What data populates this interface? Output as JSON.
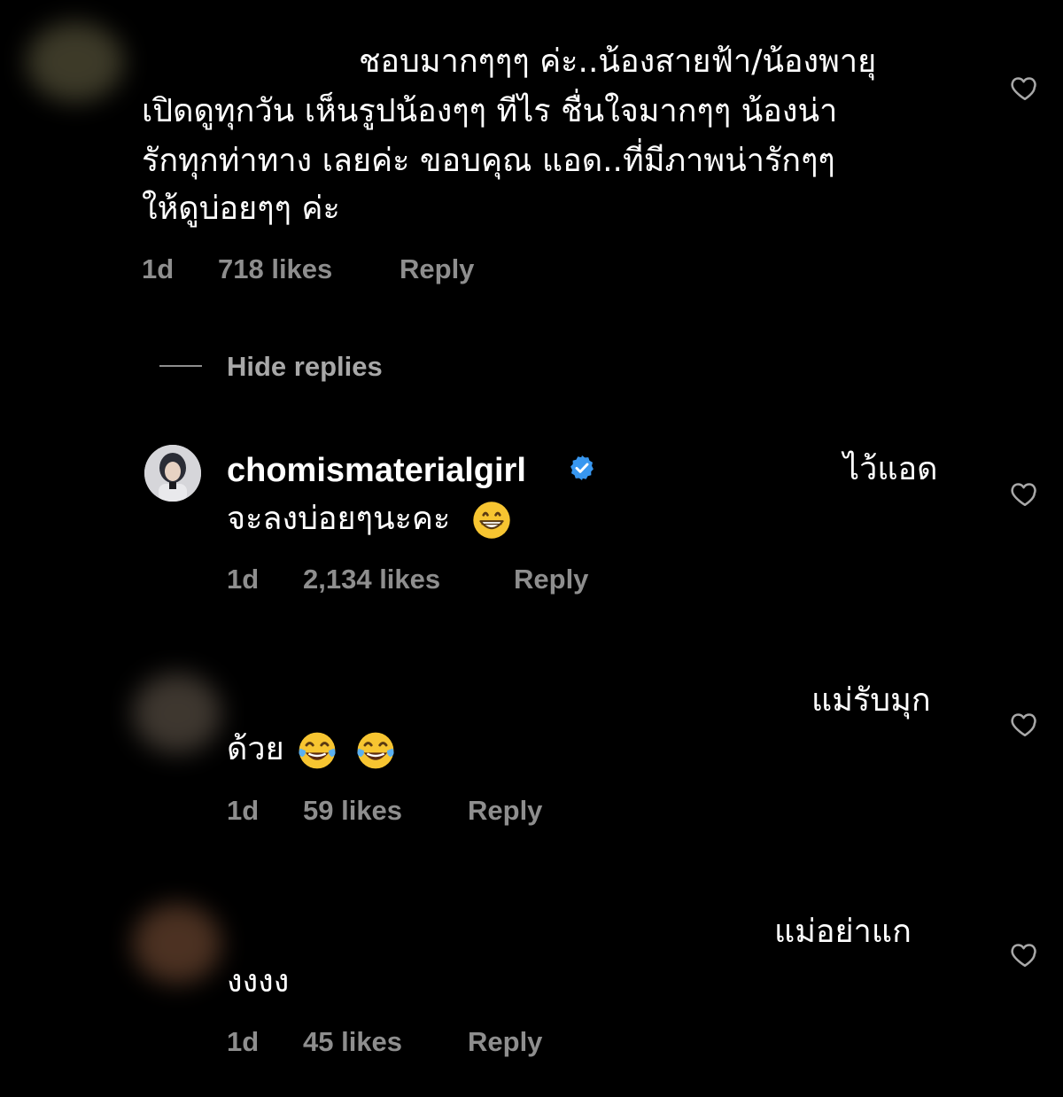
{
  "comments": [
    {
      "text_lines": [
        "ชอบมากๆๆๆ ค่ะ..น้องสายฟ้า/น้องพายุ",
        "เปิดดูทุกวัน เห็นรูปน้องๆๆ  ทีไร ชื่นใจมากๆๆ  น้องน่า",
        "รักทุกท่าทาง เลยค่ะ ขอบคุณ แอด..ที่มีภาพน่ารักๆๆ",
        "ให้ดูบ่อยๆๆ ค่ะ"
      ],
      "time": "1d",
      "likes": "718 likes",
      "reply": "Reply"
    }
  ],
  "hide_replies": "Hide replies",
  "replies": [
    {
      "username": "chomismaterialgirl",
      "verified": true,
      "text_line1": "ไว้แอด",
      "text_line2": "จะลงบ่อยๆนะคะ",
      "emoji": "grinning-face",
      "time": "1d",
      "likes": "2,134 likes",
      "reply": "Reply"
    },
    {
      "text_line1": "แม่รับมุก",
      "text_line2": "ด้วย",
      "emoji": "tears-of-joy x2",
      "time": "1d",
      "likes": "59 likes",
      "reply": "Reply"
    },
    {
      "text_line1": "แม่อย่าแก",
      "text_line2": "งงงง",
      "time": "1d",
      "likes": "45 likes",
      "reply": "Reply"
    }
  ],
  "colors": {
    "background": "#000000",
    "text": "#ffffff",
    "meta": "#8e8e8e",
    "verified": "#3897f0"
  }
}
